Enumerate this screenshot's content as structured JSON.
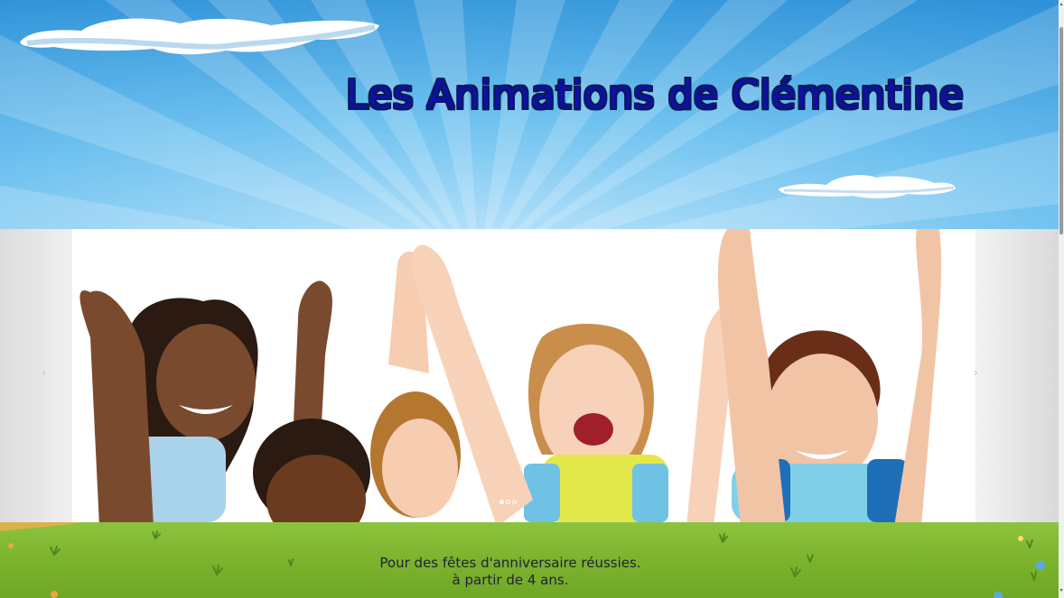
{
  "header": {
    "site_title": "Les Animations de Clémentine"
  },
  "slider": {
    "prev_label": "‹",
    "next_label": "›",
    "slide_count": 3,
    "active_slide": 1
  },
  "tagline": {
    "line1": "Pour des fêtes d'anniversaire réussies.",
    "line2": "à partir de 4 ans."
  },
  "colors": {
    "sky_blue": "#4aa9e6",
    "title_blue": "#0f0fa8",
    "grass_green": "#7cb32e"
  },
  "icons": {
    "prev": "chevron-left-icon",
    "next": "chevron-right-icon"
  }
}
